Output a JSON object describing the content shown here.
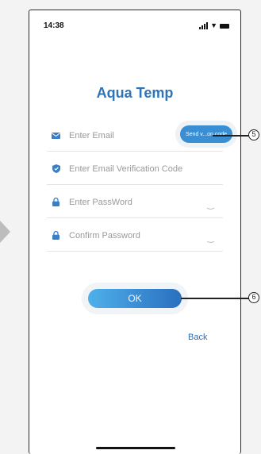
{
  "status_bar": {
    "time": "14:38"
  },
  "app_title": "Aqua Temp",
  "form": {
    "email_placeholder": "Enter Email",
    "send_code_label": "Send v...on code",
    "verification_placeholder": "Enter Email Verification Code",
    "password_placeholder": "Enter PassWord",
    "confirm_placeholder": "Confirm Password"
  },
  "ok_label": "OK",
  "back_label": "Back",
  "callouts": [
    "5",
    "6"
  ],
  "colors": {
    "accent": "#2d74b8",
    "button": "#3a8ed4"
  }
}
